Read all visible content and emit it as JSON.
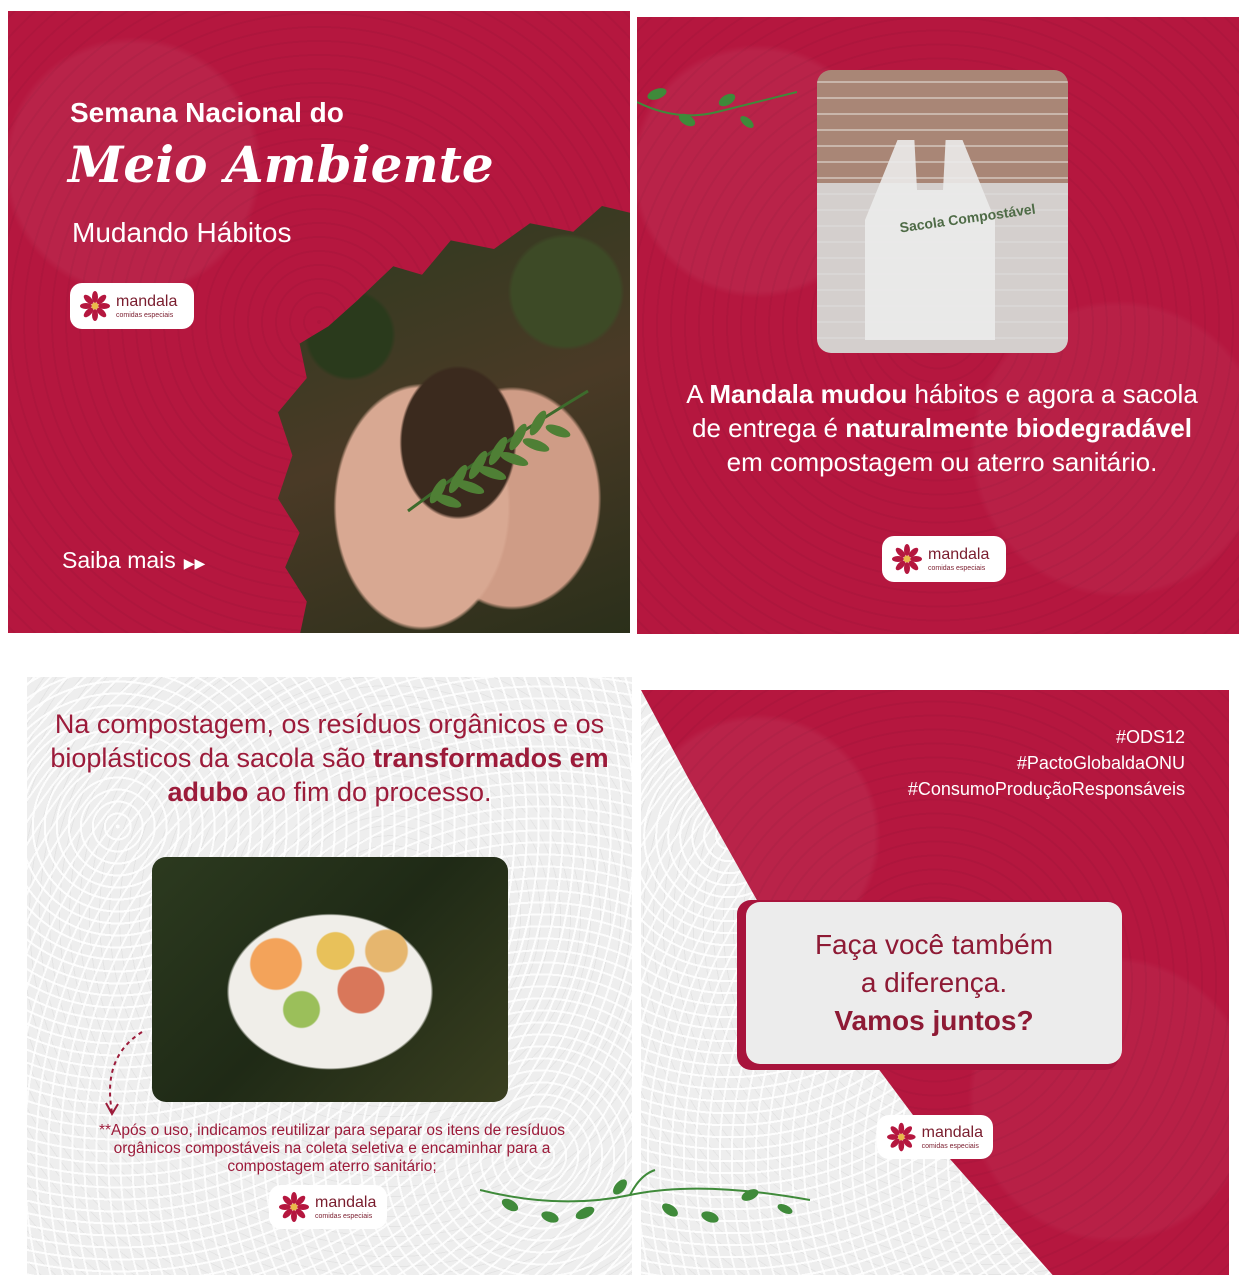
{
  "panel1": {
    "title_line1": "Semana Nacional do",
    "title_script": "Meio Ambiente",
    "subtitle": "Mudando Hábitos",
    "cta_label": "Saiba mais",
    "cta_arrows": "▶▶"
  },
  "panel2": {
    "bag_text": "Sacola Compostável",
    "desc_part1": "A ",
    "desc_bold1": "Mandala mudou",
    "desc_part2": " hábitos e agora a sacola de entrega é ",
    "desc_bold2": "naturalmente biodegradável",
    "desc_part3": " em compostagem ou aterro sanitário."
  },
  "panel3": {
    "head_part1": "Na compostagem, os resíduos orgânicos e os bioplásticos da sacola são ",
    "head_bold": "transformados em adubo",
    "head_part2": " ao fim do processo.",
    "note": "**Após o uso, indicamos reutilizar para separar os itens de resíduos orgânicos compostáveis na coleta seletiva e encaminhar para a compostagem aterro sanitário;"
  },
  "panel4": {
    "tags": [
      "#ODS12",
      "#PactoGlobaldaONU",
      "#ConsumoProduçãoResponsáveis"
    ],
    "card_line1": "Faça você também",
    "card_line2": "a diferença.",
    "card_line3": "Vamos juntos?"
  },
  "logo": {
    "name": "mandala",
    "tagline": "comidas especiais"
  },
  "colors": {
    "crimson": "#b5173f",
    "wine": "#8e1a35",
    "vine_green": "#3f8a3a"
  }
}
